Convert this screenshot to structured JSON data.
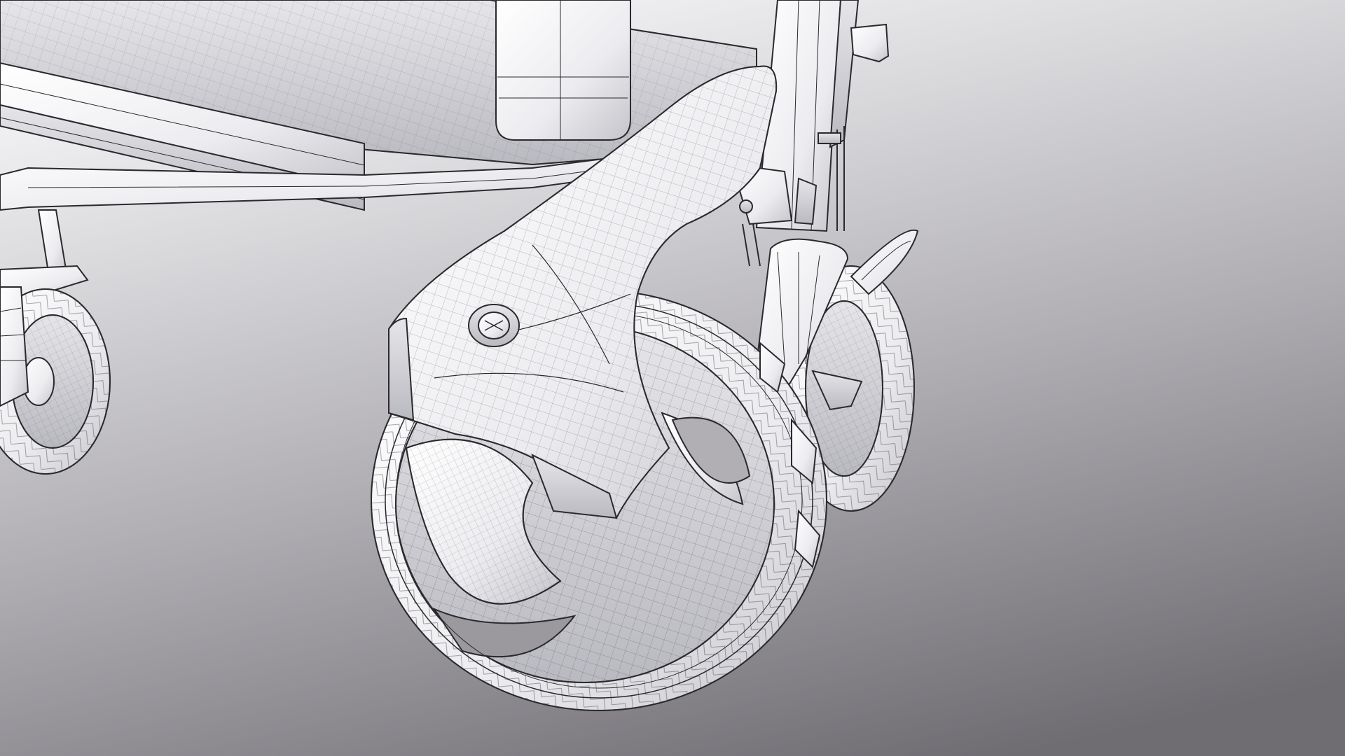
{
  "scene": {
    "subject": "wireframe-stroller-wheels",
    "colors": {
      "background_top": "#f3f3f5",
      "background_bottom": "#6f6d72",
      "surface": "#f2f2f4",
      "surface_shade": "#c9c9ce",
      "wire": "#2a2a2e"
    }
  }
}
